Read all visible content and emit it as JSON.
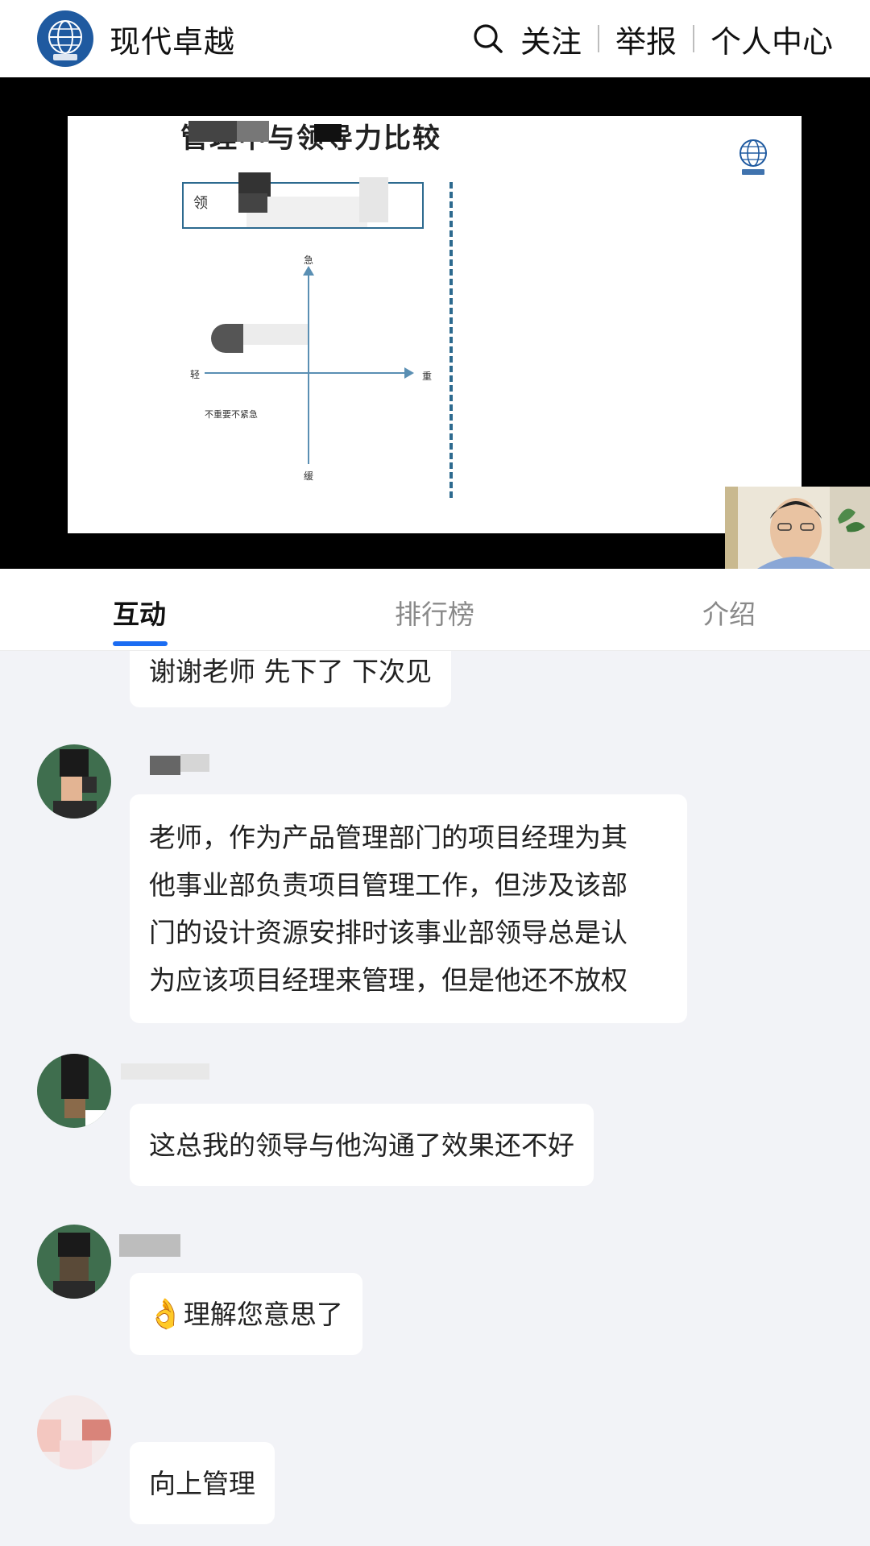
{
  "header": {
    "brand": "现代卓越",
    "nav": [
      "关注",
      "举报",
      "个人中心"
    ]
  },
  "slide": {
    "title": "管理中与领导力比较",
    "box_label": "领",
    "axis": {
      "top": "急",
      "bottom": "缓",
      "left": "轻",
      "right": "重"
    },
    "quadrant_label": "不重要不紧急"
  },
  "tabs": [
    {
      "label": "互动",
      "active": true
    },
    {
      "label": "排行榜",
      "active": false
    },
    {
      "label": "介绍",
      "active": false
    }
  ],
  "messages": [
    {
      "type": "continuation",
      "text": "谢谢老师 先下了 下次见"
    },
    {
      "username": "",
      "lines": [
        "老师，作为产品管理部门的项目经理为其",
        "他事业部负责项目管理工作，但涉及该部",
        "门的设计资源安排时该事业部领导总是认",
        "为应该项目经理来管理，但是他还不放权"
      ]
    },
    {
      "username": "",
      "text": "这总我的领导与他沟通了效果还不好"
    },
    {
      "username": "",
      "emoji": "👌",
      "text": "理解您意思了"
    },
    {
      "username": "",
      "text": "向上管理"
    }
  ],
  "colors": {
    "accent": "#1b6cf2",
    "background": "#f2f3f7",
    "brand_blue": "#1f5aa0"
  },
  "icons": [
    "search-icon",
    "globe-logo-icon",
    "ok-hand-emoji"
  ]
}
